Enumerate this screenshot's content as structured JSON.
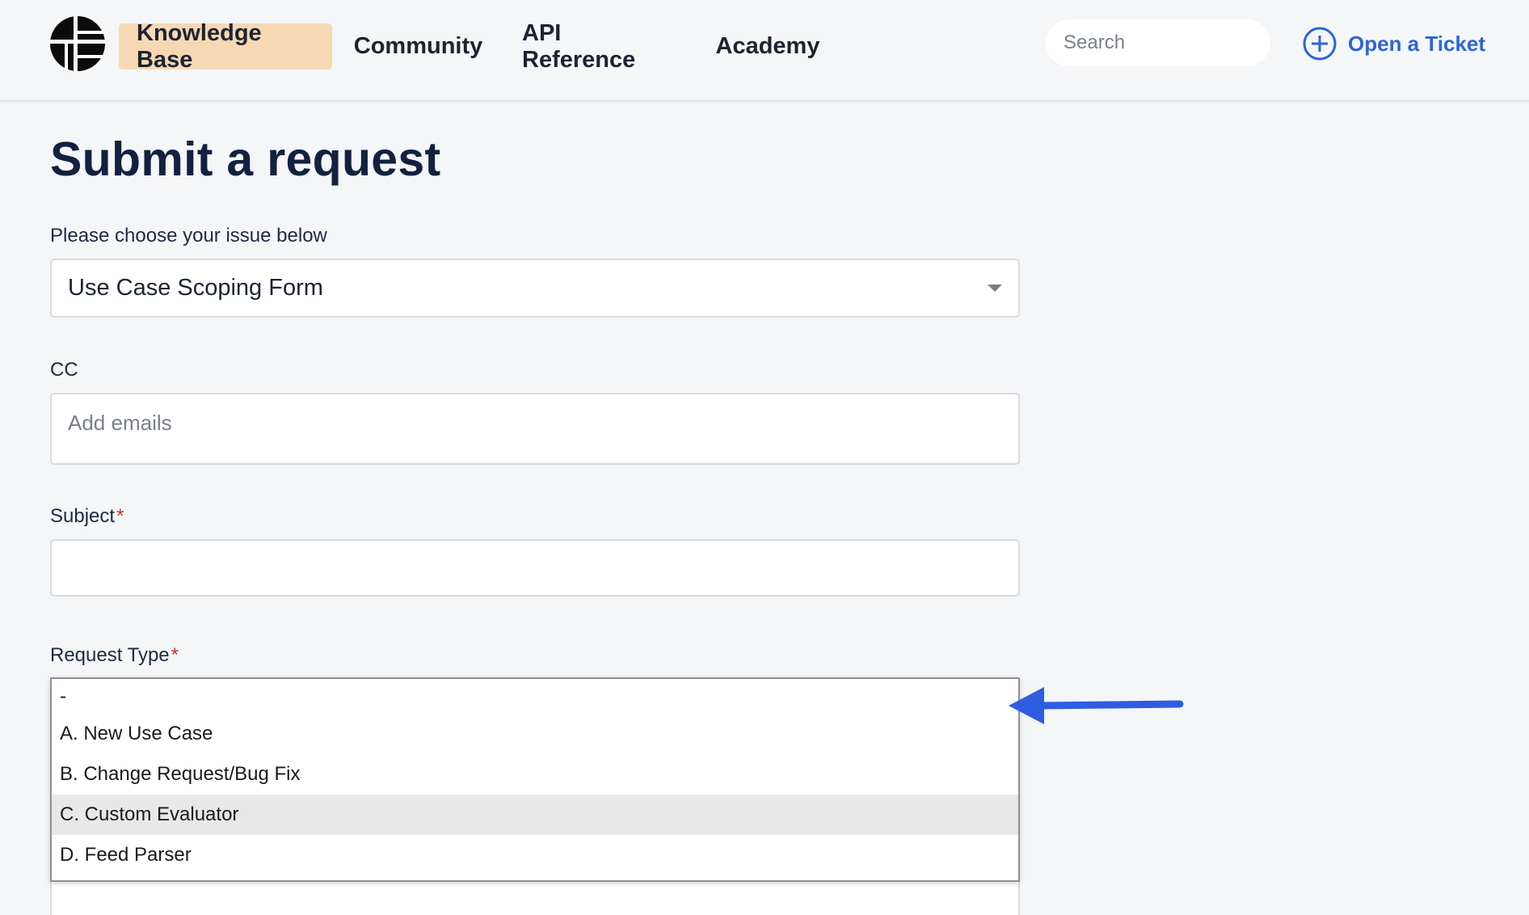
{
  "header": {
    "nav": {
      "knowledge_base": "Knowledge Base",
      "community": "Community",
      "api_reference": "API Reference",
      "academy": "Academy"
    },
    "search": {
      "placeholder": "Search",
      "value": ""
    },
    "open_ticket": "Open a Ticket"
  },
  "form": {
    "title": "Submit a request",
    "issue": {
      "label": "Please choose your issue below",
      "selected": "Use Case Scoping Form"
    },
    "cc": {
      "label": "CC",
      "placeholder": "Add emails",
      "value": ""
    },
    "subject": {
      "label": "Subject",
      "required_mark": "*",
      "value": ""
    },
    "request_type": {
      "label": "Request Type",
      "required_mark": "*",
      "options": [
        "-",
        "A. New Use Case",
        "B. Change Request/Bug Fix",
        "C. Custom Evaluator",
        "D. Feed Parser"
      ],
      "highlighted_option": "C. Custom Evaluator"
    }
  },
  "colors": {
    "accent": "#2b66d6",
    "nav_active_bg": "#f6d8b4",
    "required": "#d32f2f",
    "annotation_arrow": "#2f5de0"
  }
}
